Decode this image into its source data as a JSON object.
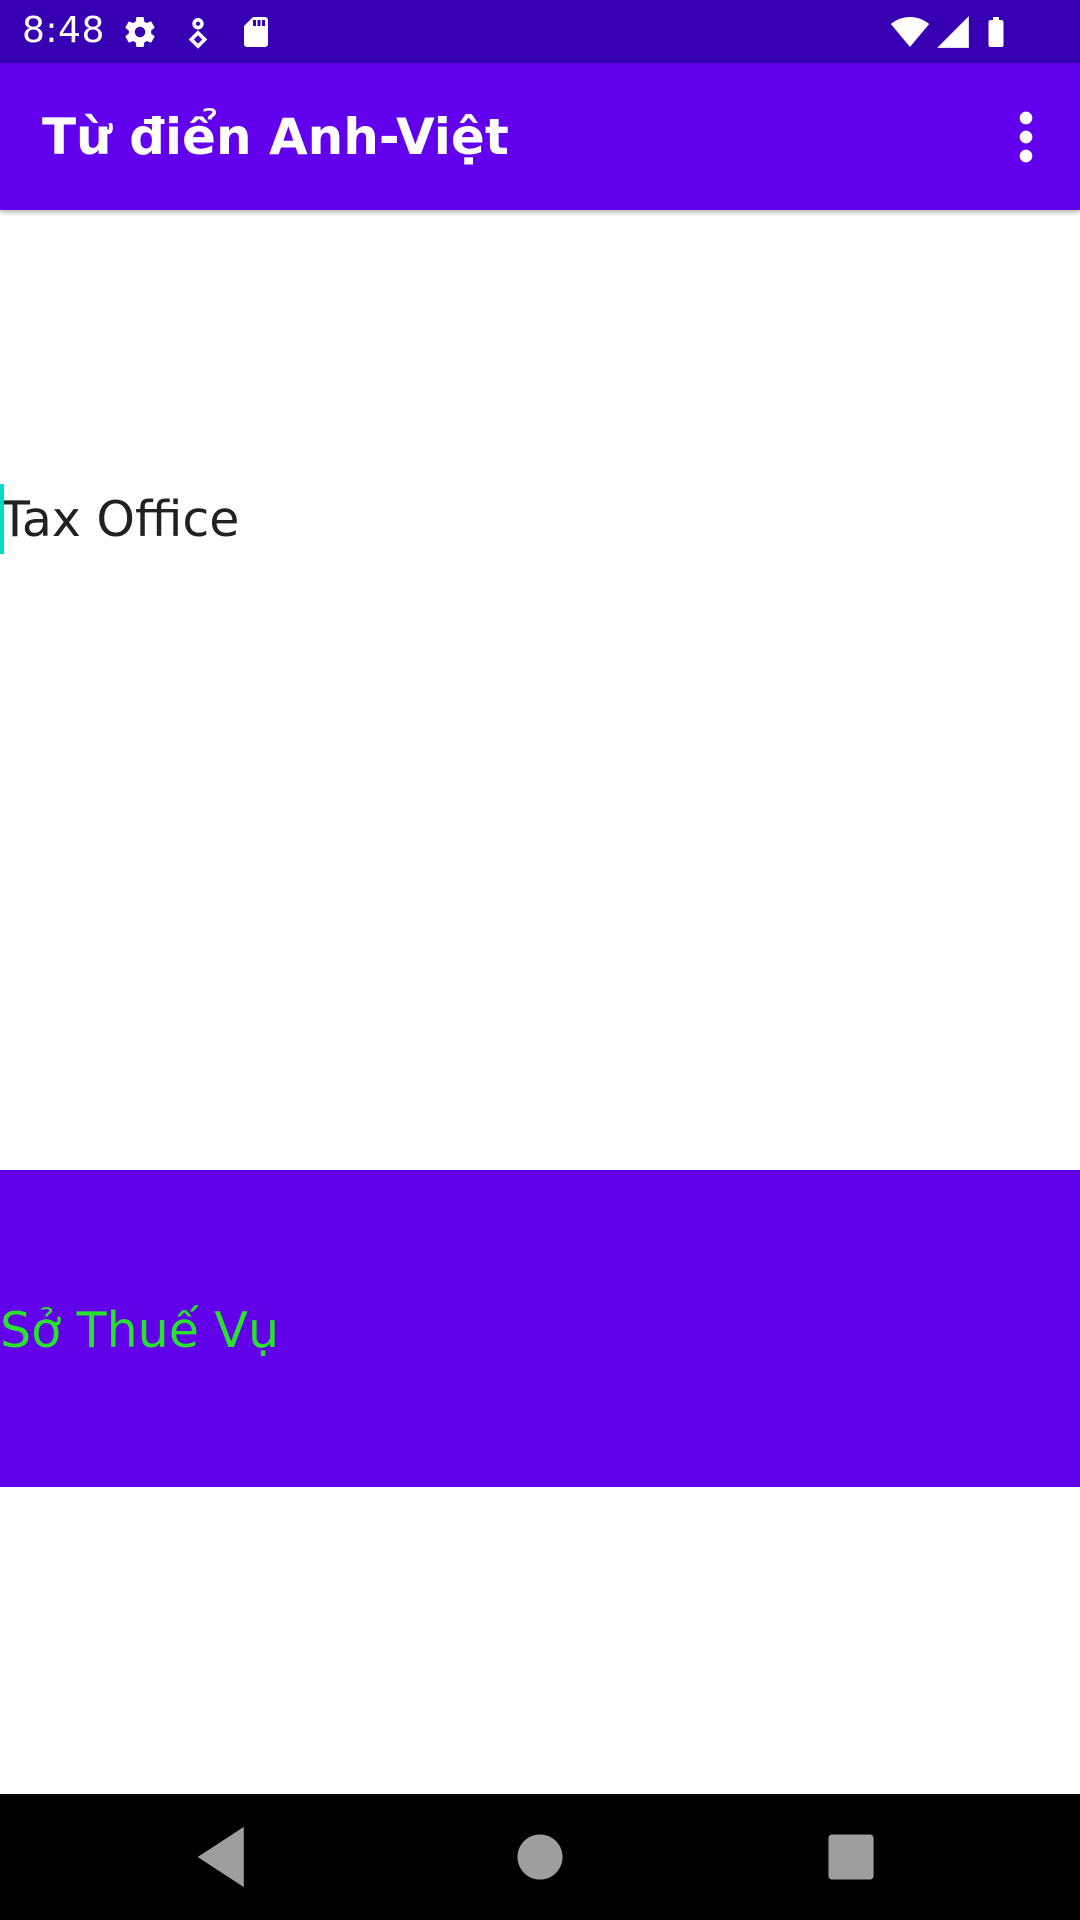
{
  "status_bar": {
    "time": "8:48",
    "icons_left": [
      "settings-icon",
      "location-pin-icon",
      "sd-card-icon"
    ],
    "icons_right": [
      "wifi-icon",
      "signal-icon",
      "battery-icon"
    ]
  },
  "app_bar": {
    "title": "Từ điển Anh-Việt",
    "overflow_icon": "more-vert-icon"
  },
  "input": {
    "value": "Tax Office"
  },
  "result": {
    "text": "Sở Thuế Vụ"
  },
  "nav_bar": {
    "icons": [
      "back-icon",
      "home-icon",
      "recents-icon"
    ]
  },
  "colors": {
    "status_bar": "#3700b3",
    "app_bar": "#6200ee",
    "result_panel": "#6200ea",
    "result_text": "#27e32b",
    "cursor": "#03dac5"
  }
}
